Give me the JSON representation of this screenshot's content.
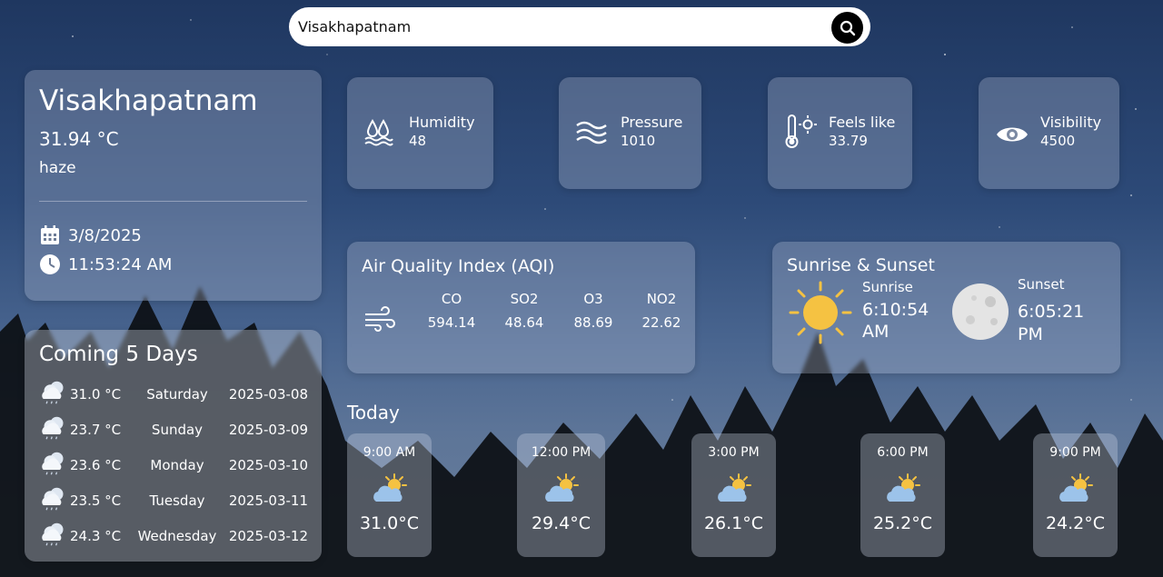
{
  "search": {
    "value": "Visakhapatnam",
    "button_icon": "search-icon"
  },
  "current": {
    "city": "Visakhapatnam",
    "temperature": "31.94 °C",
    "description": "haze",
    "date": "3/8/2025",
    "time": "11:53:24 AM"
  },
  "metrics": [
    {
      "label": "Humidity",
      "value": "48",
      "icon": "humidity-icon"
    },
    {
      "label": "Pressure",
      "value": "1010",
      "icon": "pressure-icon"
    },
    {
      "label": "Feels like",
      "value": "33.79",
      "icon": "thermometer-icon"
    },
    {
      "label": "Visibility",
      "value": "4500",
      "icon": "eye-icon"
    }
  ],
  "aqi": {
    "title": "Air Quality Index (AQI)",
    "components": [
      {
        "name": "CO",
        "value": "594.14"
      },
      {
        "name": "SO2",
        "value": "48.64"
      },
      {
        "name": "O3",
        "value": "88.69"
      },
      {
        "name": "NO2",
        "value": "22.62"
      }
    ]
  },
  "sun": {
    "title": "Sunrise & Sunset",
    "sunrise_label": "Sunrise",
    "sunrise_time": "6:10:54",
    "sunrise_ampm": "AM",
    "sunset_label": "Sunset",
    "sunset_time": "6:05:21",
    "sunset_ampm": "PM"
  },
  "forecast": {
    "title": "Coming 5 Days",
    "days": [
      {
        "temp": "31.0 °C",
        "day": "Saturday",
        "date": "2025-03-08"
      },
      {
        "temp": "23.7 °C",
        "day": "Sunday",
        "date": "2025-03-09"
      },
      {
        "temp": "23.6 °C",
        "day": "Monday",
        "date": "2025-03-10"
      },
      {
        "temp": "23.5 °C",
        "day": "Tuesday",
        "date": "2025-03-11"
      },
      {
        "temp": "24.3 °C",
        "day": "Wednesday",
        "date": "2025-03-12"
      }
    ]
  },
  "today": {
    "title": "Today",
    "hours": [
      {
        "time": "9:00 AM",
        "temp": "31.0°C"
      },
      {
        "time": "12:00 PM",
        "temp": "29.4°C"
      },
      {
        "time": "3:00 PM",
        "temp": "26.1°C"
      },
      {
        "time": "6:00 PM",
        "temp": "25.2°C"
      },
      {
        "time": "9:00 PM",
        "temp": "24.2°C"
      }
    ]
  },
  "colors": {
    "sun": "#f5c242",
    "cloud": "#9cc3ea",
    "moon": "#e4e4e4"
  }
}
